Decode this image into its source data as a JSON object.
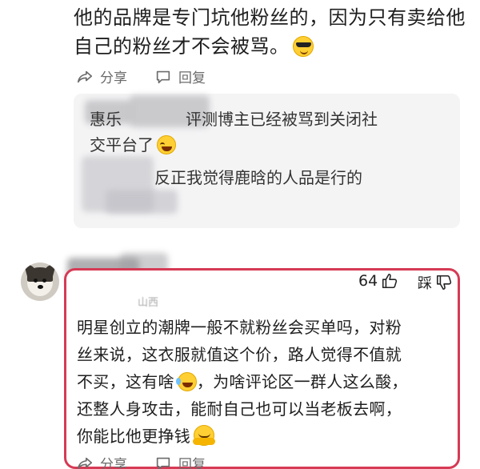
{
  "top_comment": {
    "line1": "他的品牌是专门坑他粉丝的，因为只有卖给他",
    "line2": "自己的粉丝才不会被骂。",
    "emoji": "cool-sunglasses-emoji"
  },
  "actions": {
    "share_label": "分享",
    "reply_label": "回复"
  },
  "replies": [
    {
      "name": "惠乐",
      "text": "评测博主已经被骂到关闭社",
      "text2": "交平台了",
      "emoji": "laughing-emoji"
    },
    {
      "text": "反正我觉得鹿晗的人品是行的"
    }
  ],
  "main_comment": {
    "location": "山西",
    "likes": "64",
    "dislike_label": "踩",
    "lines": [
      "明星创立的潮牌一般不就粉丝会买单吗，对粉",
      "丝来说，这衣服就值这个价，路人觉得不值就",
      "不买，这有啥",
      "，为啥评论区一群人这么酸，",
      "还整人身攻击，能耐自己也可以当老板去啊，",
      "你能比他更挣钱"
    ],
    "share_label": "分享",
    "reply_label": "回复"
  },
  "colors": {
    "highlight_border": "#d63a55",
    "reply_bg": "#f4f4f5",
    "action_gray": "#6b6b6b"
  }
}
